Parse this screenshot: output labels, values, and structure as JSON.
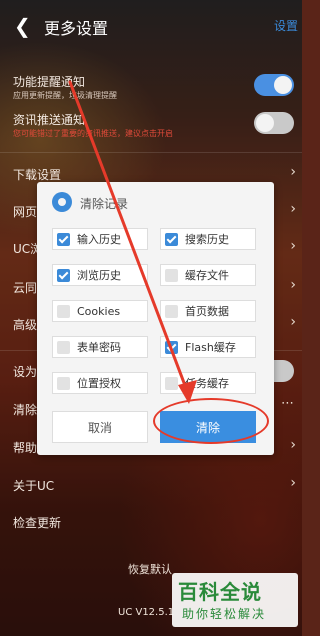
{
  "header": {
    "back_icon": "arrow-left-icon",
    "title": "更多设置",
    "right_label": "设置"
  },
  "settings": {
    "notify": {
      "label": "功能提醒通知",
      "sub": "应用更新提醒，垃圾清理提醒",
      "on": true
    },
    "news": {
      "label": "资讯推送通知",
      "sub": "您可能错过了重要的资讯推送，建议点击开启",
      "on": false
    },
    "download": {
      "label": "下载设置"
    },
    "web_partial": {
      "label": "网页"
    },
    "uc_partial": {
      "label": "UC浏"
    },
    "cloud_partial": {
      "label": "云同"
    },
    "advanced_partial": {
      "label": "高级"
    },
    "default_partial": {
      "label": "设为"
    },
    "clear_partial": {
      "label": "清除"
    },
    "help_partial": {
      "label": "帮助"
    },
    "about": {
      "label": "关于UC"
    },
    "check_update": {
      "label": "检查更新"
    },
    "restore_partial": {
      "label": "恢复默认"
    },
    "version_partial": {
      "label": "UC V12.5.1"
    }
  },
  "dialog": {
    "title": "清除记录",
    "options": [
      {
        "label": "输入历史",
        "checked": true
      },
      {
        "label": "搜索历史",
        "checked": true
      },
      {
        "label": "浏览历史",
        "checked": true
      },
      {
        "label": "缓存文件",
        "checked": false
      },
      {
        "label": "Cookies",
        "checked": false
      },
      {
        "label": "首页数据",
        "checked": false
      },
      {
        "label": "表单密码",
        "checked": false
      },
      {
        "label": "Flash缓存",
        "checked": true
      },
      {
        "label": "位置授权",
        "checked": false
      },
      {
        "label": "任务缓存",
        "checked": false
      }
    ],
    "cancel_label": "取消",
    "confirm_label": "清除"
  },
  "watermark": {
    "big": "百科全说",
    "small": "助你轻松解决"
  },
  "colors": {
    "accent": "#3a8ee0",
    "annotation": "#e53a2a",
    "watermark": "#2a8a3a"
  }
}
